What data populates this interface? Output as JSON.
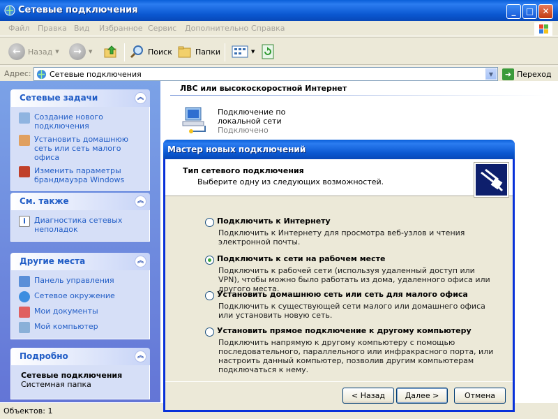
{
  "window": {
    "title": "Сетевые подключения"
  },
  "menu": [
    "Файл",
    "Правка",
    "Вид",
    "Избранное",
    "Сервис",
    "Дополнительно",
    "Справка"
  ],
  "toolbar": {
    "back": "Назад",
    "search": "Поиск",
    "folders": "Папки"
  },
  "address": {
    "label": "Адрес:",
    "value": "Сетевые подключения",
    "go": "Переход"
  },
  "sidebar": {
    "network_tasks": {
      "title": "Сетевые задачи",
      "items": [
        "Создание нового подключения",
        "Установить домашнюю сеть или сеть малого офиса",
        "Изменить параметры брандмауэра Windows"
      ]
    },
    "see_also": {
      "title": "См. также",
      "items": [
        "Диагностика сетевых неполадок"
      ]
    },
    "other_places": {
      "title": "Другие места",
      "items": [
        "Панель управления",
        "Сетевое окружение",
        "Мои документы",
        "Мой компьютер"
      ]
    },
    "details": {
      "title": "Подробно",
      "name": "Сетевые подключения",
      "type": "Системная папка"
    }
  },
  "content": {
    "group": "ЛВС или высокоскоростной Интернет",
    "connection": {
      "name": "Подключение по локальной сети",
      "status": "Подключено"
    }
  },
  "status": {
    "text": "Объектов: 1"
  },
  "wizard": {
    "title": "Мастер новых подключений",
    "heading": "Тип сетевого подключения",
    "subheading": "Выберите одну из следующих возможностей.",
    "options": [
      {
        "title": "Подключить к Интернету",
        "desc": "Подключить к Интернету для просмотра веб-узлов и чтения  электронной почты.",
        "selected": false
      },
      {
        "title": "Подключить к сети на рабочем месте",
        "desc": "Подключить к рабочей сети (используя удаленный доступ или VPN), чтобы можно было работать из дома, удаленного офиса или другого места.",
        "selected": true
      },
      {
        "title": "Установить домашнюю сеть или сеть для малого офиса",
        "desc": "Подключить к существующей сети малого или домашнего офиса или установить новую сеть.",
        "selected": false
      },
      {
        "title": "Установить прямое подключение к другому компьютеру",
        "desc": "Подключить напрямую к другому компьютеру с помощью последовательного, параллельного или инфракрасного порта, или настроить данный компьютер, позволив другим  компьютерам подключаться к нему.",
        "selected": false
      }
    ],
    "buttons": {
      "back": "< Назад",
      "next": "Далее >",
      "cancel": "Отмена"
    }
  }
}
